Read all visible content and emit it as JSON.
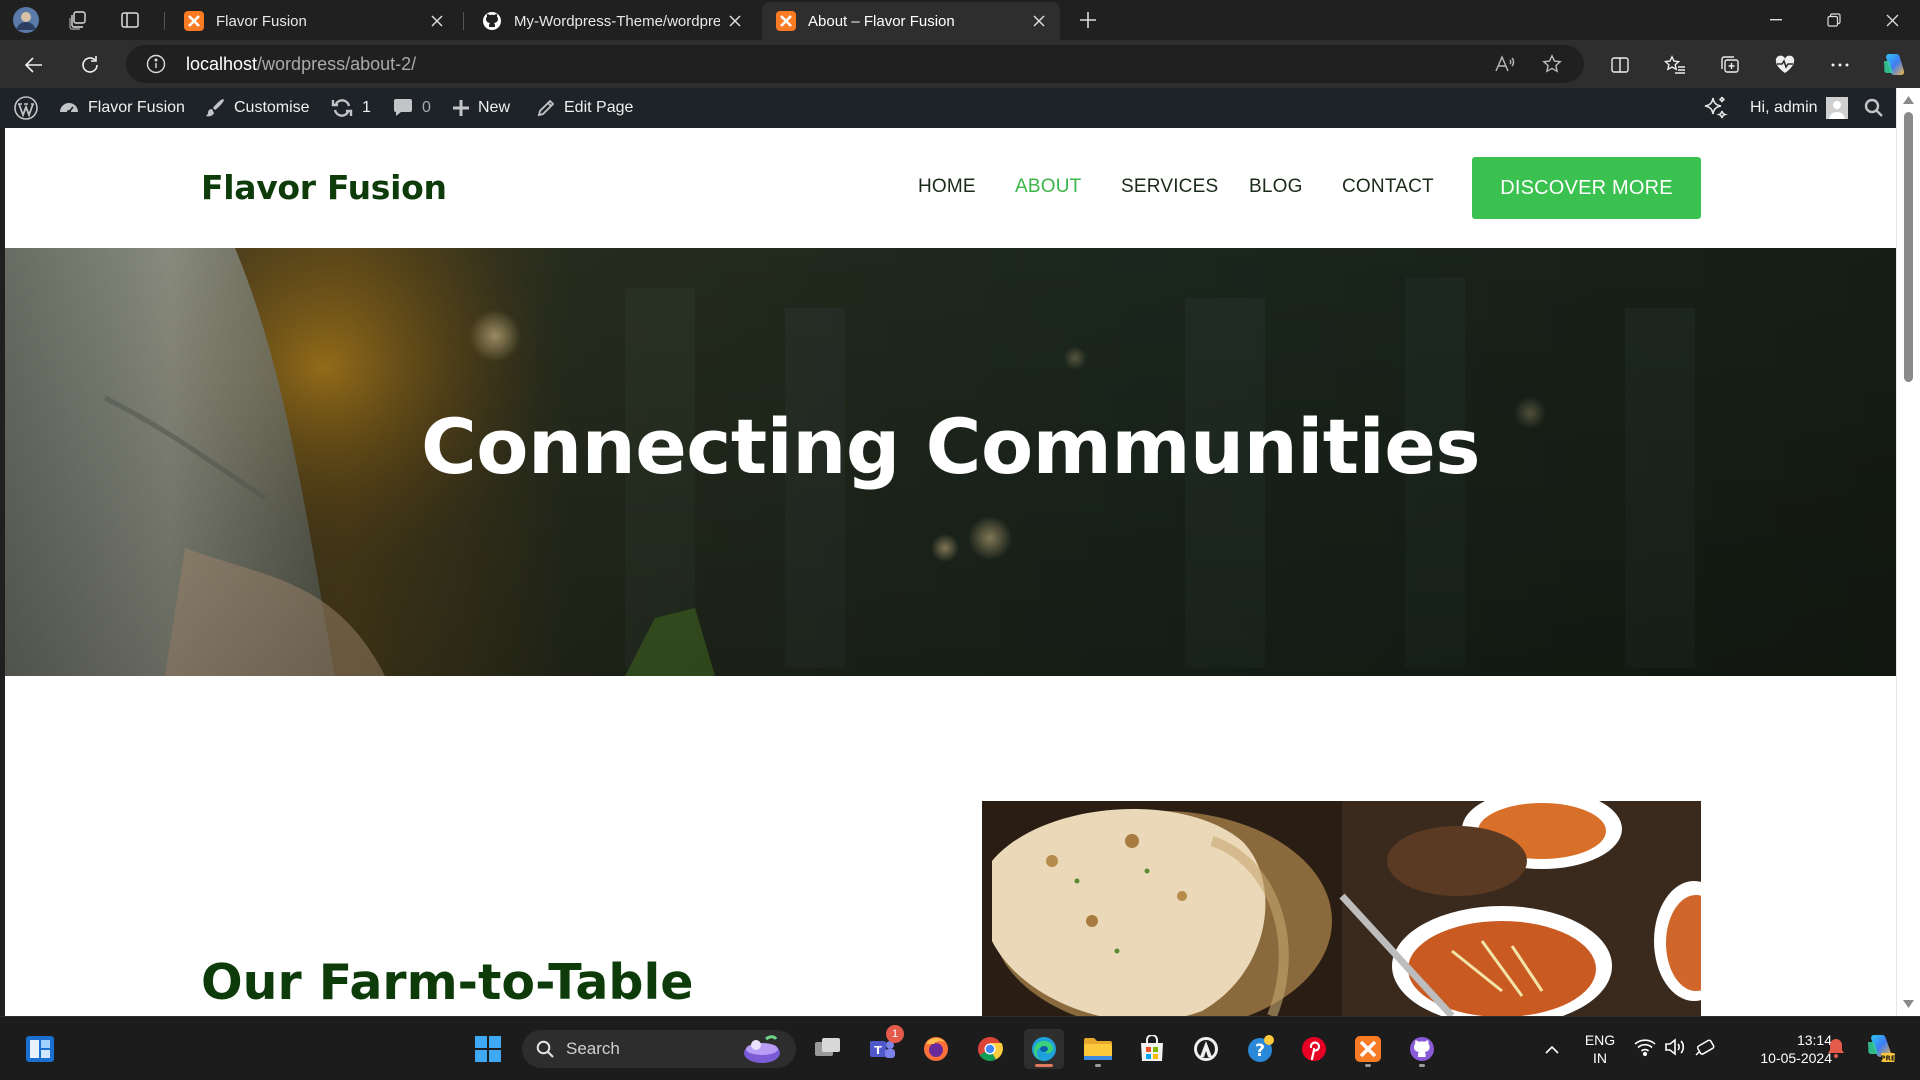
{
  "browser": {
    "tabs": [
      {
        "title": "Flavor Fusion",
        "icon": "xampp-icon",
        "active": false
      },
      {
        "title": "My-Wordpress-Theme/wordpres",
        "icon": "github-icon",
        "active": false
      },
      {
        "title": "About – Flavor Fusion",
        "icon": "xampp-icon",
        "active": true
      }
    ],
    "address": {
      "host": "localhost",
      "path": "/wordpress/about-2/"
    }
  },
  "admin_bar": {
    "site_name": "Flavor Fusion",
    "customise": "Customise",
    "updates_count": "1",
    "comments_count": "0",
    "new_label": "New",
    "edit_label": "Edit Page",
    "greeting": "Hi, admin"
  },
  "site": {
    "title": "Flavor Fusion",
    "menu": [
      {
        "label": "HOME",
        "current": false
      },
      {
        "label": "ABOUT",
        "current": true
      },
      {
        "label": "SERVICES",
        "current": false
      },
      {
        "label": "BLOG",
        "current": false
      },
      {
        "label": "CONTACT",
        "current": false
      }
    ],
    "cta_label": "DISCOVER MORE",
    "hero_title": "Connecting Communities",
    "section_heading": "Our Farm-to-Table",
    "colors": {
      "brand_dark_green": "#0d3b0a",
      "accent_green": "#3bc150",
      "admin_bar": "#1d2327"
    }
  },
  "taskbar": {
    "search_label": "Search",
    "teams_badge": "1",
    "lang_top": "ENG",
    "lang_bottom": "IN",
    "time": "13:14",
    "date": "10-05-2024",
    "apps": [
      "windows-start-icon",
      "task-view-icon",
      "teams-icon",
      "firefox-icon",
      "chrome-icon",
      "edge-icon",
      "file-explorer-icon",
      "microsoft-store-icon",
      "app-icon",
      "help-icon",
      "pinterest-icon",
      "xampp-icon",
      "github-desktop-icon"
    ]
  }
}
